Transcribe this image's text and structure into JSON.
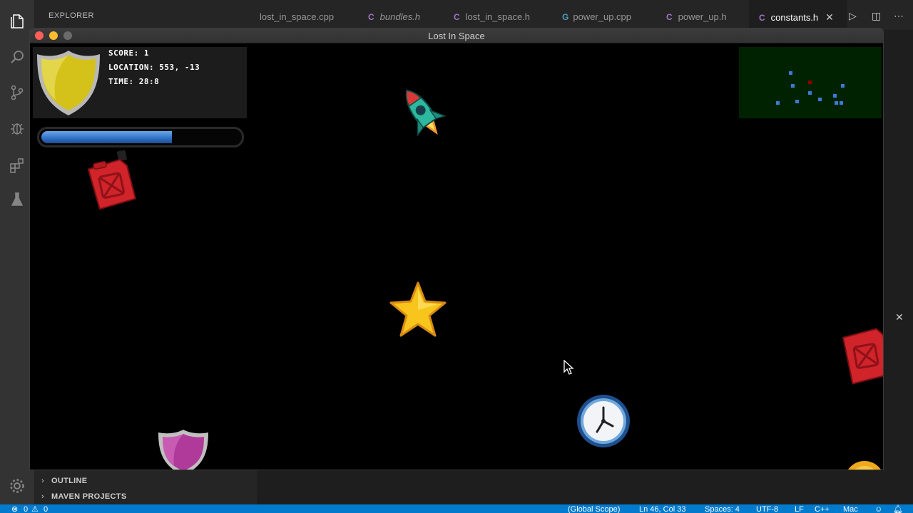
{
  "vscode": {
    "sidebar_title": "EXPLORER",
    "sections": [
      "OUTLINE",
      "MAVEN PROJECTS"
    ],
    "tabs": [
      {
        "label": "lost_in_space.cpp",
        "kind": "",
        "active": false
      },
      {
        "label": "bundles.h",
        "kind": "C",
        "active": false
      },
      {
        "label": "lost_in_space.h",
        "kind": "C",
        "active": false
      },
      {
        "label": "power_up.cpp",
        "kind": "G",
        "active": false
      },
      {
        "label": "power_up.h",
        "kind": "C",
        "active": false
      },
      {
        "label": "constants.h",
        "kind": "C",
        "active": true
      }
    ],
    "status_bar": {
      "errors": "0",
      "warnings": "0",
      "scope": "(Global Scope)",
      "position": "Ln 46, Col 33",
      "spaces": "Spaces: 4",
      "encoding": "UTF-8",
      "eol": "LF",
      "language": "C++",
      "platform": "Mac"
    }
  },
  "game": {
    "window_title": "Lost In Space",
    "hud": {
      "score": "SCORE: 1",
      "location": "LOCATION: 553, -13",
      "time": "TIME: 28:8",
      "fuel_level": 0.66
    },
    "colors": {
      "shield": "#d4c21a",
      "fuel_bar": "#3a7bd5",
      "minimap": "#002200",
      "minimap_dot": "#3a7bd5",
      "minimap_player": "#8b0000"
    },
    "sprites": [
      "rocket-ship",
      "fuel-can",
      "star-power-up",
      "clock-power-up",
      "shield-power-up",
      "fuel-can",
      "coin"
    ]
  }
}
